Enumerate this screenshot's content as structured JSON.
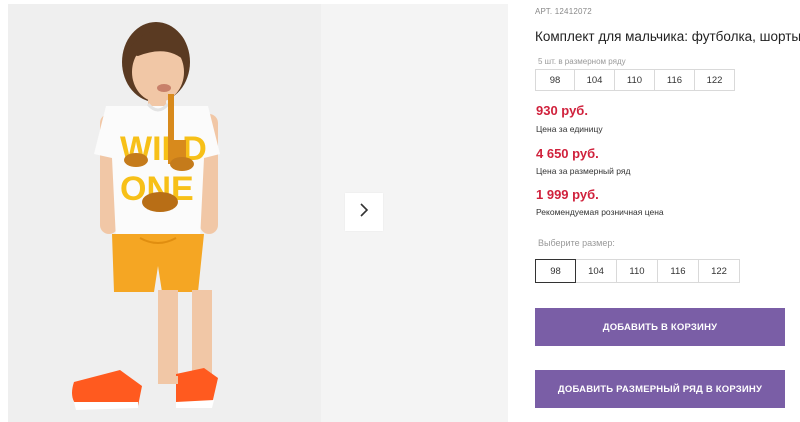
{
  "product": {
    "art": "АРТ. 12412072",
    "title": "Комплект для мальчика: футболка, шорты",
    "set_note": "5 шт. в размерном ряду",
    "set_sizes": [
      "98",
      "104",
      "110",
      "116",
      "122"
    ]
  },
  "prices": {
    "unit": {
      "value": "930 руб.",
      "label": "Цена за единицу"
    },
    "set": {
      "value": "4 650 руб.",
      "label": "Цена за размерный ряд"
    },
    "retail": {
      "value": "1 999 руб.",
      "label": "Рекомендуемая розничная цена"
    }
  },
  "size_select": {
    "label": "Выберите размер:",
    "options": [
      "98",
      "104",
      "110",
      "116",
      "122"
    ],
    "selected": "98"
  },
  "buttons": {
    "add_to_cart": "ДОБАВИТЬ В КОРЗИНУ",
    "add_set_to_cart": "ДОБАВИТЬ РАЗМЕРНЫЙ РЯД В КОРЗИНУ"
  },
  "gallery": {
    "tshirt_print": "WILD ONE",
    "next_icon": "chevron-right-icon"
  },
  "colors": {
    "price": "#d0213c",
    "button": "#7a5ea6",
    "shorts": "#f5a623",
    "shoes": "#ff5a1f"
  }
}
